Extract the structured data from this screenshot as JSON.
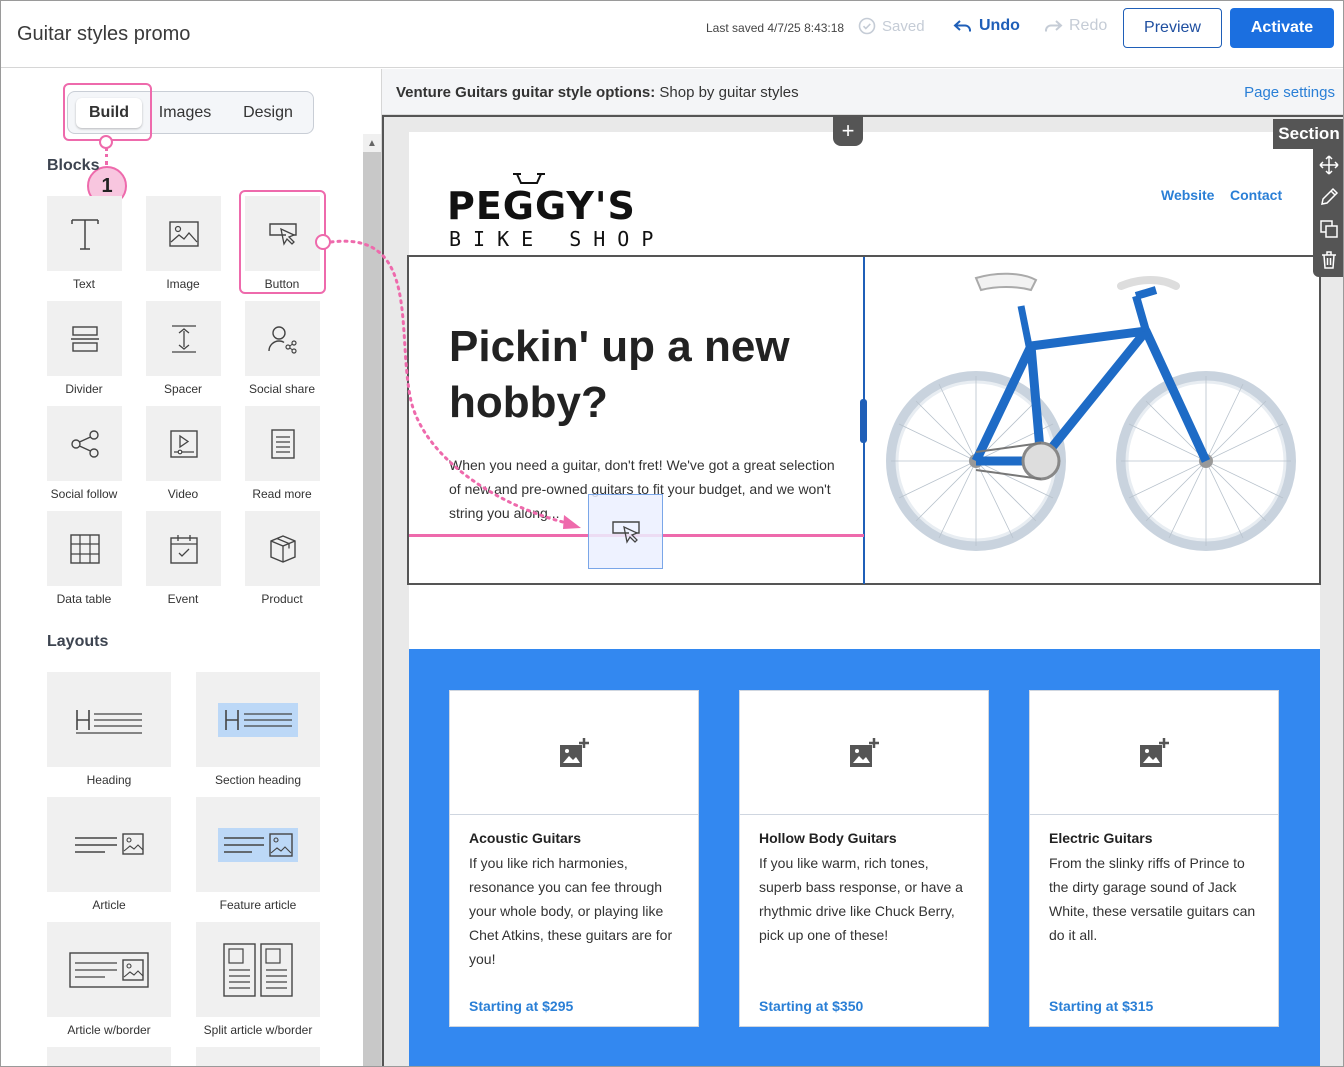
{
  "header": {
    "app_title": "Guitar styles promo",
    "last_saved": "Last saved 4/7/25 8:43:18",
    "saved_label": "Saved",
    "undo_label": "Undo",
    "redo_label": "Redo",
    "preview_label": "Preview",
    "activate_label": "Activate"
  },
  "sidebar": {
    "tabs": [
      "Build",
      "Images",
      "Design"
    ],
    "active_tab": "Build",
    "callout_number": "1",
    "blocks_heading": "Blocks",
    "blocks": [
      {
        "label": "Text",
        "icon": "text-icon"
      },
      {
        "label": "Image",
        "icon": "image-icon"
      },
      {
        "label": "Button",
        "icon": "button-cursor-icon"
      },
      {
        "label": "Divider",
        "icon": "divider-icon"
      },
      {
        "label": "Spacer",
        "icon": "spacer-icon"
      },
      {
        "label": "Social share",
        "icon": "social-share-icon"
      },
      {
        "label": "Social follow",
        "icon": "social-follow-icon"
      },
      {
        "label": "Video",
        "icon": "video-icon"
      },
      {
        "label": "Read more",
        "icon": "read-more-icon"
      },
      {
        "label": "Data table",
        "icon": "data-table-icon"
      },
      {
        "label": "Event",
        "icon": "event-icon"
      },
      {
        "label": "Product",
        "icon": "product-icon"
      }
    ],
    "layouts_heading": "Layouts",
    "layouts": [
      {
        "label": "Heading"
      },
      {
        "label": "Section heading"
      },
      {
        "label": "Article"
      },
      {
        "label": "Feature article"
      },
      {
        "label": "Article w/border"
      },
      {
        "label": "Split article w/border"
      }
    ]
  },
  "canvas": {
    "title_bold": "Venture Guitars guitar style options:",
    "title_rest": "Shop by guitar styles",
    "page_settings": "Page settings",
    "section_label": "Section",
    "plus": "+"
  },
  "email": {
    "logo_main": "PEGGY'S",
    "logo_sub": "BIKE SHOP",
    "nav": [
      "Website",
      "Contact"
    ],
    "hero_title": "Pickin' up a new hobby?",
    "hero_body": "When you need a guitar, don't fret! We've got a great selection of new and pre-owned guitars to fit your budget, and we won't string you along...",
    "cards": [
      {
        "title": "Acoustic Guitars",
        "body": "If you like rich harmonies, resonance you can fee through your whole body, or playing like Chet Atkins, these guitars are for you!",
        "price": "Starting at $295"
      },
      {
        "title": "Hollow Body Guitars",
        "body": "If you like warm, rich tones, superb bass response, or have a rhythmic drive like Chuck Berry, pick up one of these!",
        "price": "Starting at $350"
      },
      {
        "title": "Electric Guitars",
        "body": "From the slinky riffs of Prince to the dirty garage sound of Jack White, these versatile guitars can do it all.",
        "price": "Starting at $315"
      }
    ]
  },
  "colors": {
    "accent": "#1b6fe0",
    "highlight": "#ee6aac",
    "band": "#3388f0",
    "link": "#2a7fd6"
  }
}
